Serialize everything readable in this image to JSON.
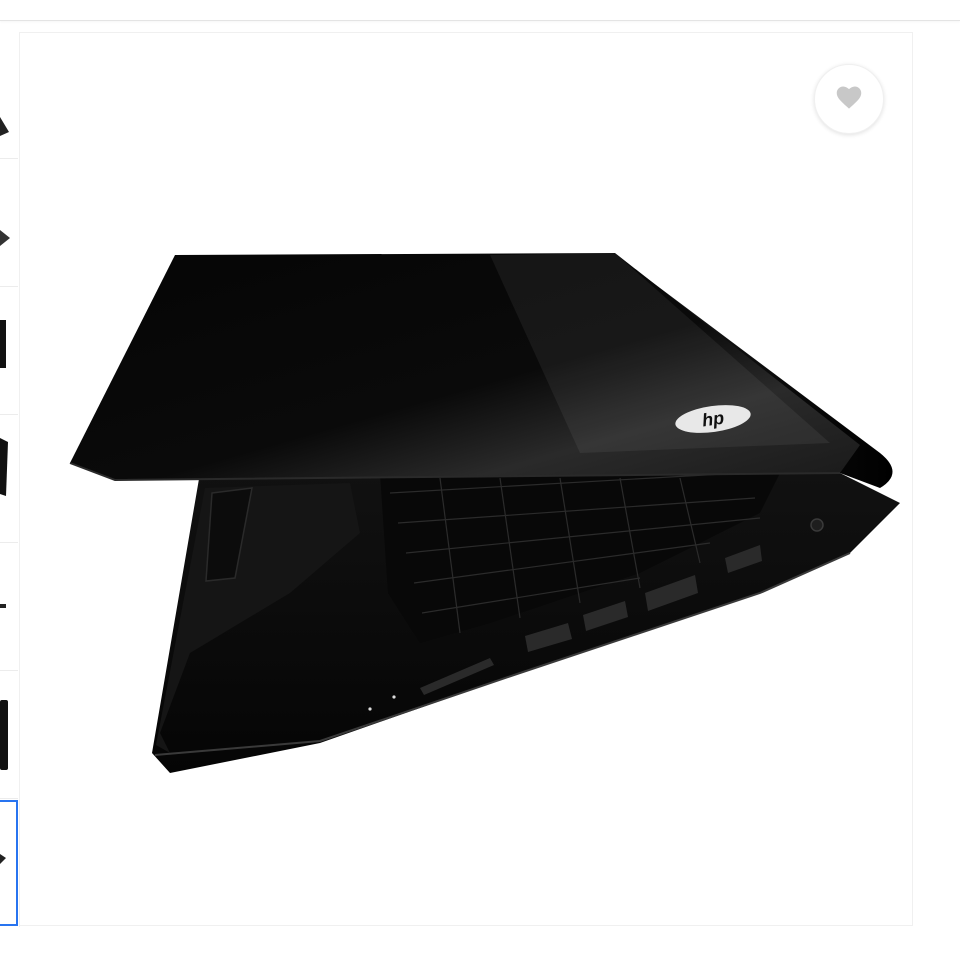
{
  "gallery": {
    "thumbnail_count": 7,
    "selected_index": 6,
    "main_image_alt_icon": "laptop-image",
    "brand_logo_text": "hp"
  },
  "actions": {
    "wishlist_icon": "heart-icon"
  },
  "colors": {
    "selected_border": "#2874f0",
    "heart": "#c8c8c8",
    "laptop_body": "#0b0b0b"
  }
}
